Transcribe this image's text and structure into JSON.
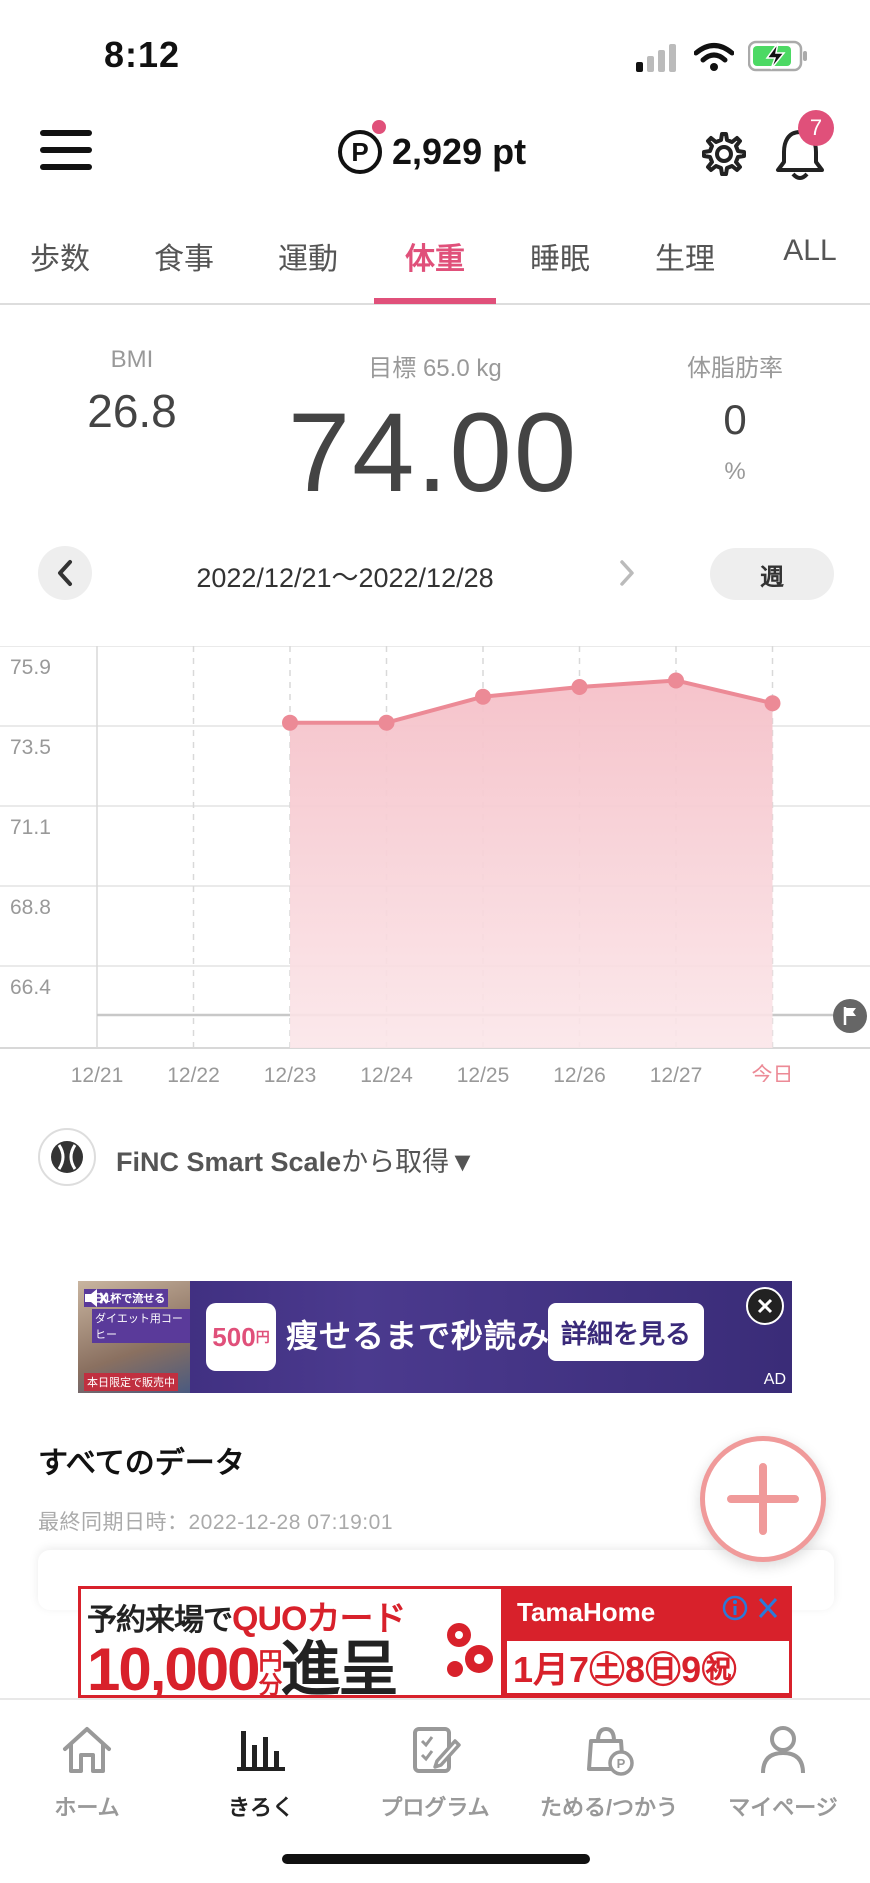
{
  "status_bar": {
    "time": "8:12"
  },
  "header": {
    "points": "2,929 pt",
    "points_icon_letter": "P",
    "notification_count": "7"
  },
  "tabs": [
    {
      "label": "歩数",
      "active": false
    },
    {
      "label": "食事",
      "active": false
    },
    {
      "label": "運動",
      "active": false
    },
    {
      "label": "体重",
      "active": true
    },
    {
      "label": "睡眠",
      "active": false
    },
    {
      "label": "生理",
      "active": false
    },
    {
      "label": "ALL",
      "active": false
    }
  ],
  "metrics": {
    "bmi_label": "BMI",
    "bmi_value": "26.8",
    "target_label": "目標 65.0 kg",
    "weight_value": "74.00",
    "body_fat_label": "体脂肪率",
    "body_fat_value": "0",
    "body_fat_unit": "%"
  },
  "date_nav": {
    "range": "2022/12/21〜2022/12/28",
    "period_button": "週"
  },
  "chart_data": {
    "type": "area",
    "x": [
      "12/21",
      "12/22",
      "12/23",
      "12/24",
      "12/25",
      "12/26",
      "12/27",
      "今日"
    ],
    "series": [
      {
        "values": [
          null,
          null,
          74.0,
          74.0,
          74.8,
          75.1,
          75.3,
          74.6
        ]
      }
    ],
    "y_ticks": [
      "75.9",
      "73.5",
      "71.1",
      "68.8",
      "66.4"
    ],
    "ylim": [
      65.0,
      75.9
    ],
    "target_line": 65.0,
    "grid": true,
    "colors": {
      "line": "#ec8a96",
      "fill": "#f5c5cc",
      "today_label": "#ec8a96"
    }
  },
  "device": {
    "name": "FiNC Smart Scale",
    "suffix": "から取得▼"
  },
  "ad1": {
    "image_caption_1": "1日1杯で流せる",
    "image_caption_2": "ダイエット用コーヒー",
    "image_caption_3": "本日限定で販売中",
    "price": "500",
    "price_unit": "円",
    "headline": "痩せるまで秒読み!",
    "cta": "詳細を見る",
    "tag": "AD"
  },
  "all_data": {
    "title": "すべてのデータ",
    "last_sync": "最終同期日時：2022-12-28 07:19:01"
  },
  "ad2": {
    "line1_a": "予約来場で",
    "line1_b": "QUOカード",
    "amount": "10,000",
    "amount_unit_1": "円",
    "amount_unit_2": "分",
    "gift": "進呈",
    "brand": "TamaHome",
    "dates": "1月7㊏8㊐9㊗"
  },
  "bottom_nav": [
    {
      "label": "ホーム",
      "icon": "home-icon",
      "active": false
    },
    {
      "label": "きろく",
      "icon": "chart-icon",
      "active": true
    },
    {
      "label": "プログラム",
      "icon": "program-icon",
      "active": false
    },
    {
      "label": "ためる/つかう",
      "icon": "points-bag-icon",
      "active": false
    },
    {
      "label": "マイページ",
      "icon": "person-icon",
      "active": false
    }
  ]
}
